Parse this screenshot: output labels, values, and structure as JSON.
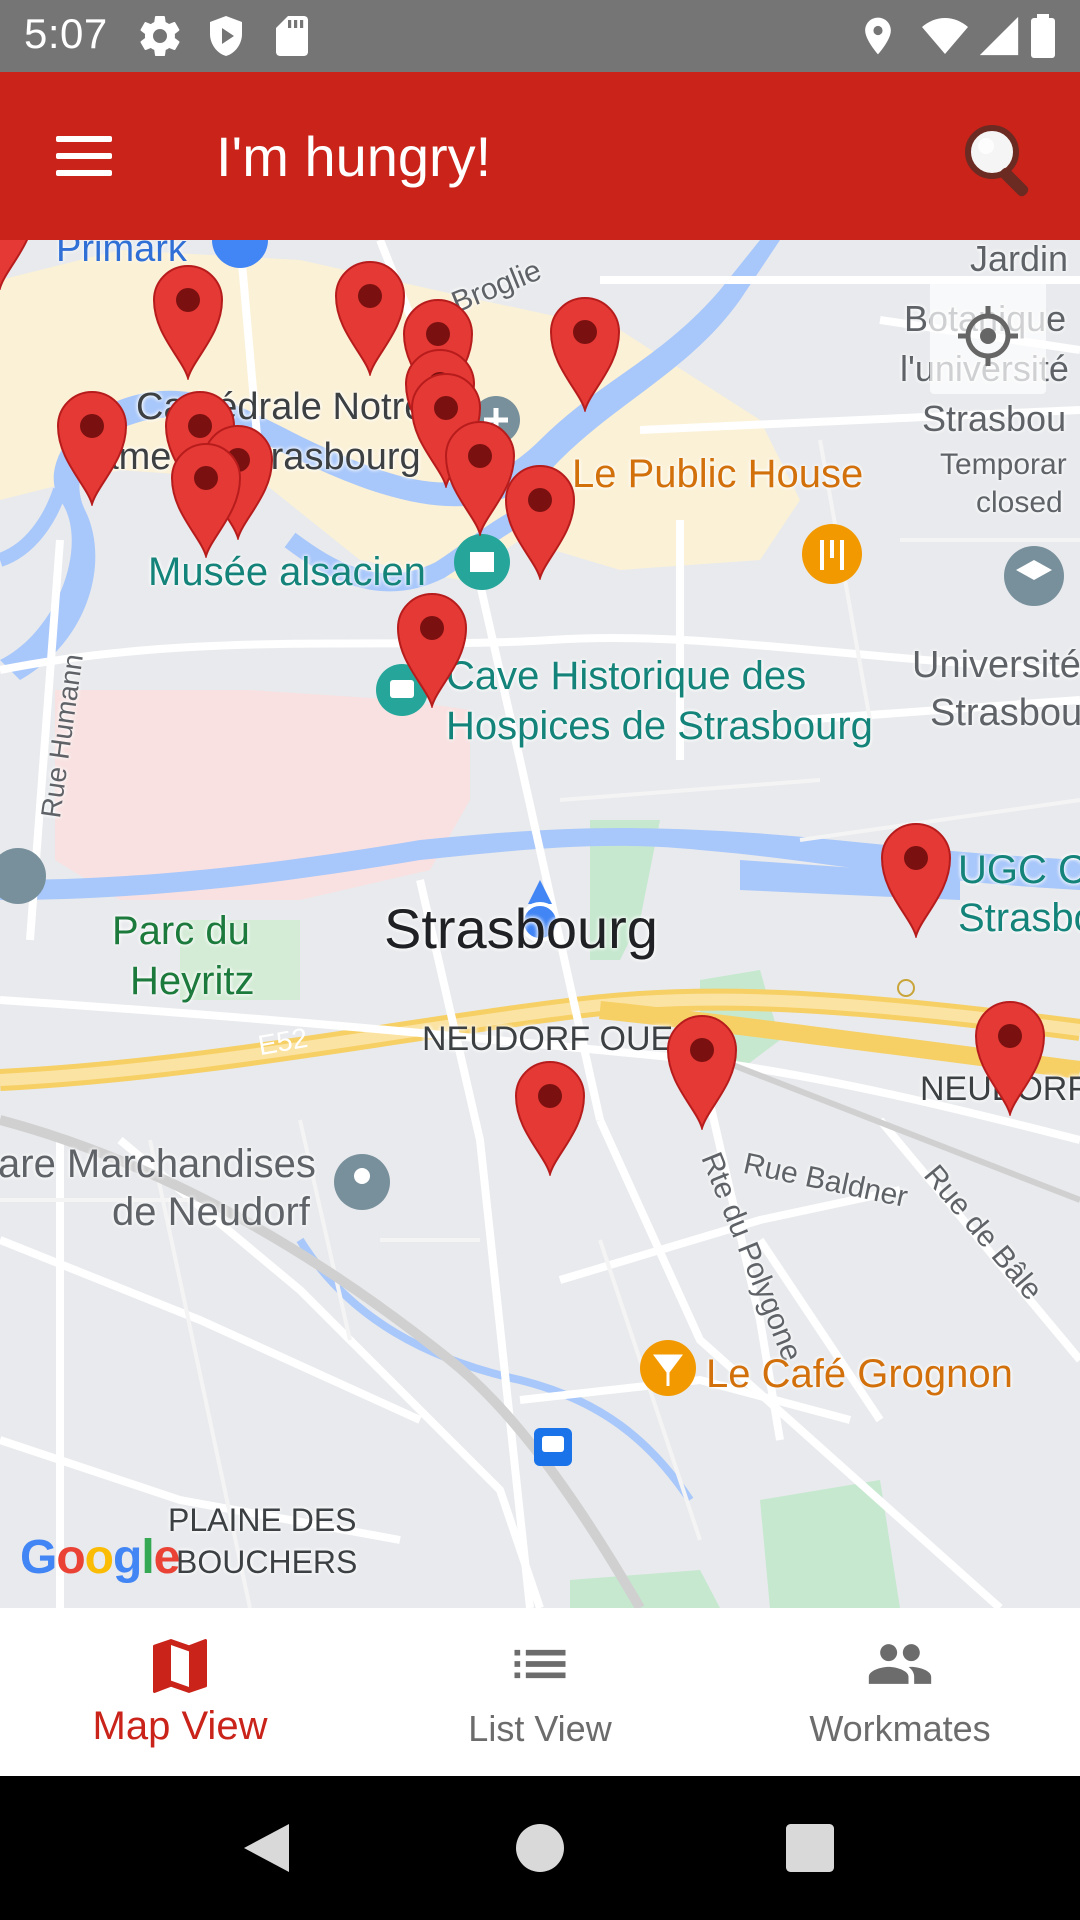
{
  "status_bar": {
    "time": "5:07",
    "left_icons": [
      "gear-icon",
      "shield-play-icon",
      "sd-card-icon"
    ],
    "right_icons": [
      "location-icon",
      "wifi-icon",
      "signal-icon",
      "battery-icon"
    ]
  },
  "app_bar": {
    "title": "I'm hungry!",
    "menu_icon": "hamburger-icon",
    "search_icon": "search-icon",
    "color": "#c9231a"
  },
  "map": {
    "city_label": "Strasbourg",
    "labels": {
      "primark": "Primark",
      "broglie": "Broglie",
      "jardin": "Jardin",
      "botanique": "Botanique",
      "universite_short": "l'université",
      "strasbou": "Strasbou",
      "temporar": "Temporar",
      "closed": "closed",
      "cathedrale": "Cathédrale Notre",
      "dame": "Dame de Strasbourg",
      "public_house": "Le Public House",
      "musee": "Musée alsacien",
      "cave1": "Cave Historique des",
      "cave2": "Hospices de Strasbourg",
      "universite1": "Université",
      "universite2": "Strasbou",
      "rue_humann": "Rue Humann",
      "ugc1": "UGC Ci",
      "ugc2": "Strasbo",
      "parc1": "Parc du",
      "parc2": "Heyritz",
      "e52": "E52",
      "neudorf_ouest": "NEUDORF OUEST",
      "neudorf_right": "NEUDORF",
      "gare1": "are Marchandises",
      "gare2": "de Neudorf",
      "rue_baldner": "Rue Baldner",
      "rte_polygone": "Rte du Polygone",
      "rue_bale": "Rue de Bâle",
      "cafe_grognon": "Le Café Grognon",
      "plaine1": "PLAINE DES",
      "plaine2": "BOUCHERS"
    },
    "google_logo": "Google",
    "marker_color": "#e53935",
    "marker_count": 19
  },
  "bottom_nav": {
    "items": [
      {
        "label": "Map View",
        "icon": "map-icon",
        "active": true
      },
      {
        "label": "List View",
        "icon": "list-icon",
        "active": false
      },
      {
        "label": "Workmates",
        "icon": "people-icon",
        "active": false
      }
    ],
    "active_color": "#c9231a"
  },
  "system_nav": {
    "buttons": [
      "back-icon",
      "home-icon",
      "recents-icon"
    ]
  }
}
